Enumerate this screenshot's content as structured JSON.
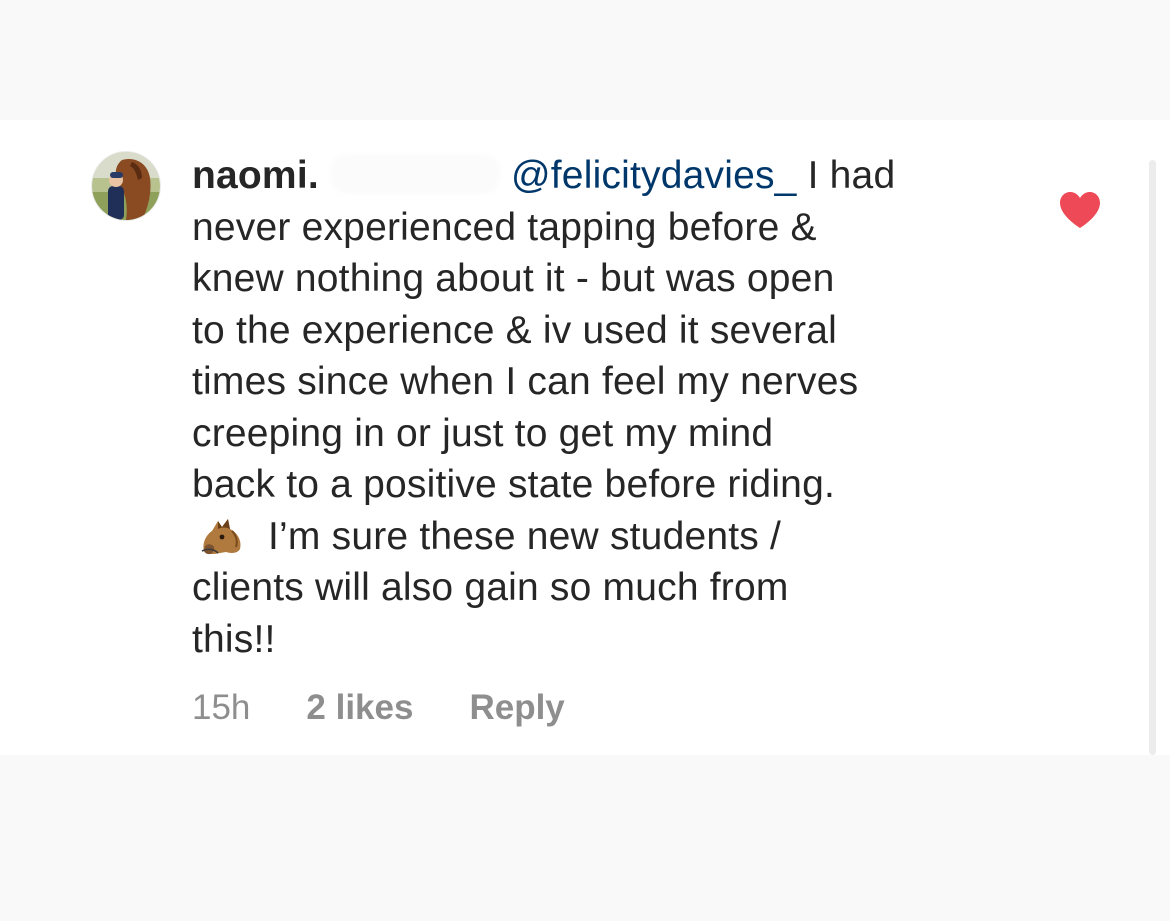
{
  "comment": {
    "username": "naomi.",
    "mention": "@felicitydavies_",
    "lines": [
      " I had",
      "never experienced tapping before &",
      "knew nothing about it - but was open",
      "to the experience & iv used it several",
      "times since when I can feel my nerves",
      "creeping in or just to get my mind",
      "back to a positive state before riding.",
      "I’m sure these new students /",
      "clients will also gain so much from",
      "this!!"
    ],
    "emoji": "horse-face-icon"
  },
  "meta": {
    "time": "15h",
    "likes": "2 likes",
    "reply": "Reply"
  },
  "colors": {
    "text": "#262626",
    "mention": "#00376b",
    "muted": "#8e8e8e",
    "like": "#ed4956"
  }
}
